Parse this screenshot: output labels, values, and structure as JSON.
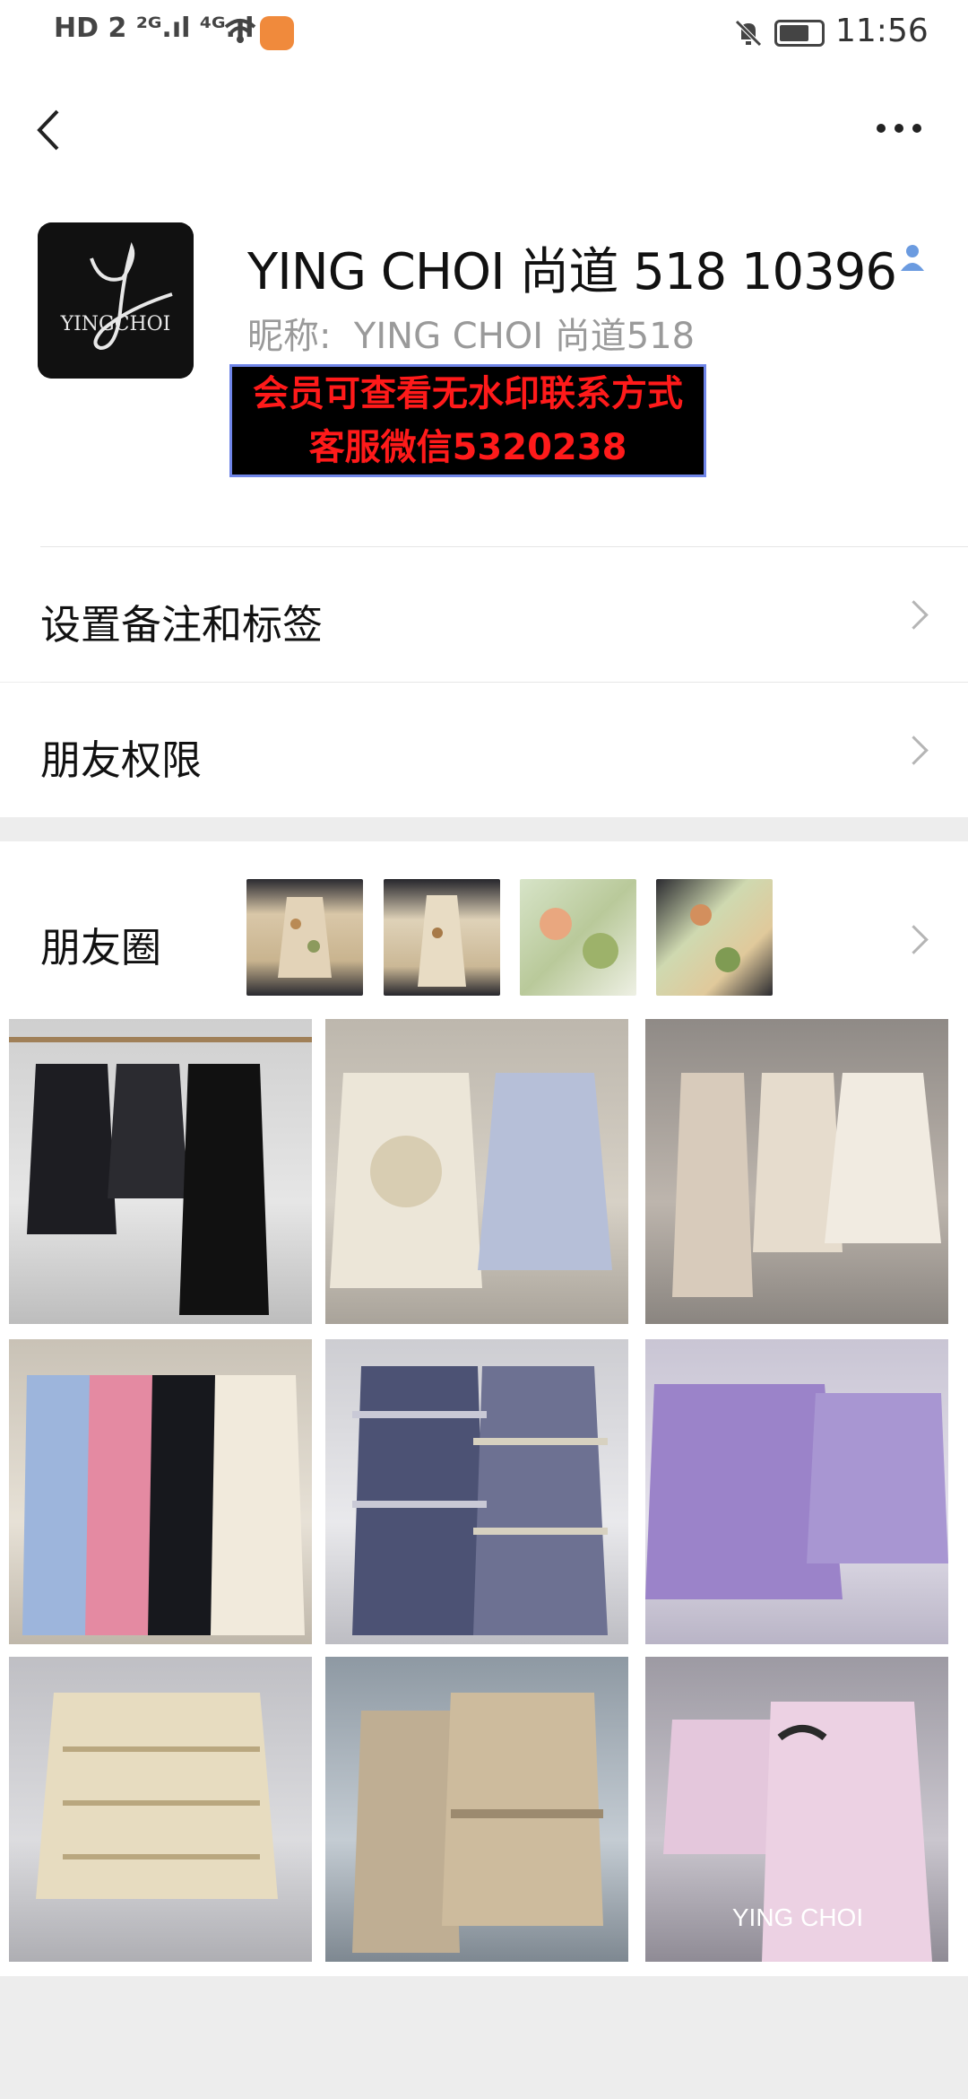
{
  "status_bar": {
    "left_indicators": "HD 2  ²ᴳ.ıl  ⁴ᴳ.ıl",
    "time": "11:56"
  },
  "header": {
    "back_icon": "chevron-left-icon",
    "more_icon": "more-dots-icon"
  },
  "profile": {
    "avatar_text": "YINGCHOI",
    "name": "YING CHOI 尚道 518 10396",
    "nickname_label": "昵称:",
    "nickname": "YING CHOI 尚道518",
    "watermark_line1": "会员可查看无水印联系方式",
    "watermark_line2": "客服微信5320238"
  },
  "rows": [
    {
      "label": "设置备注和标签"
    },
    {
      "label": "朋友权限"
    }
  ],
  "moments": {
    "label": "朋友圈"
  },
  "grid_overlay_text": "YING CHOI",
  "colors": {
    "background": "#ededed",
    "watermark_text": "#ff1a1a",
    "watermark_border": "#6f85e8",
    "contact_icon": "#6b9be0"
  }
}
